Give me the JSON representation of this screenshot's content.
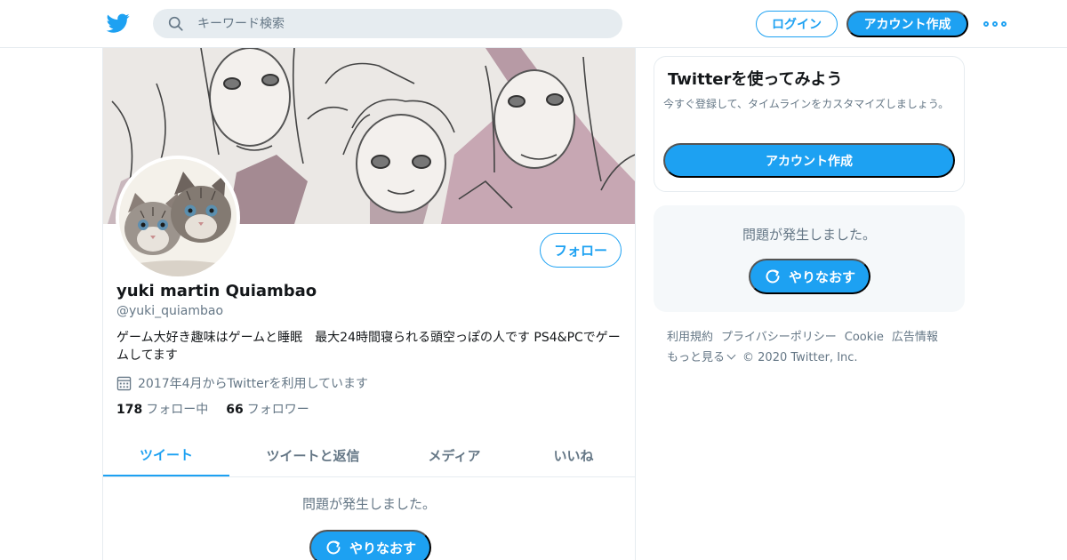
{
  "topbar": {
    "logo_icon": "twitter-bird-icon",
    "search_placeholder": "キーワード検索",
    "search_icon": "search-icon",
    "login_label": "ログイン",
    "signup_label": "アカウント作成",
    "more_icon": "more-dots-icon"
  },
  "colors": {
    "accent": "#1da1f2",
    "text_primary": "#14171a",
    "text_secondary": "#657786",
    "border": "#e6ecf0",
    "panel_bg": "#f5f8fa"
  },
  "profile": {
    "banner_image": "manga-style-illustration-banner",
    "avatar_image": "kittens-avatar",
    "follow_label": "フォロー",
    "name": "yuki martin Quiambao",
    "handle": "@yuki_quiambao",
    "bio": "ゲーム大好き趣味はゲームと睡眠　最大24時間寝られる頭空っぽの人です PS4&PCでゲームしてます",
    "joined_icon": "calendar-icon",
    "joined": "2017年4月からTwitterを利用しています",
    "following_count": "178",
    "following_label": "フォロー中",
    "followers_count": "66",
    "followers_label": "フォロワー"
  },
  "tabs": [
    {
      "label": "ツイート",
      "active": true
    },
    {
      "label": "ツイートと返信",
      "active": false
    },
    {
      "label": "メディア",
      "active": false
    },
    {
      "label": "いいね",
      "active": false
    }
  ],
  "timeline": {
    "error_text": "問題が発生しました。",
    "retry_label": "やりなおす",
    "retry_icon": "refresh-icon"
  },
  "sidebar": {
    "promo_title": "Twitterを使ってみよう",
    "promo_text": "今すぐ登録して、タイムラインをカスタマイズしましょう。",
    "promo_button": "アカウント作成",
    "error_text": "問題が発生しました。",
    "retry_label": "やりなおす"
  },
  "footer": {
    "links": [
      "利用規約",
      "プライバシーポリシー",
      "Cookie",
      "広告情報"
    ],
    "more_label": "もっと見る",
    "copyright": "© 2020 Twitter, Inc."
  }
}
